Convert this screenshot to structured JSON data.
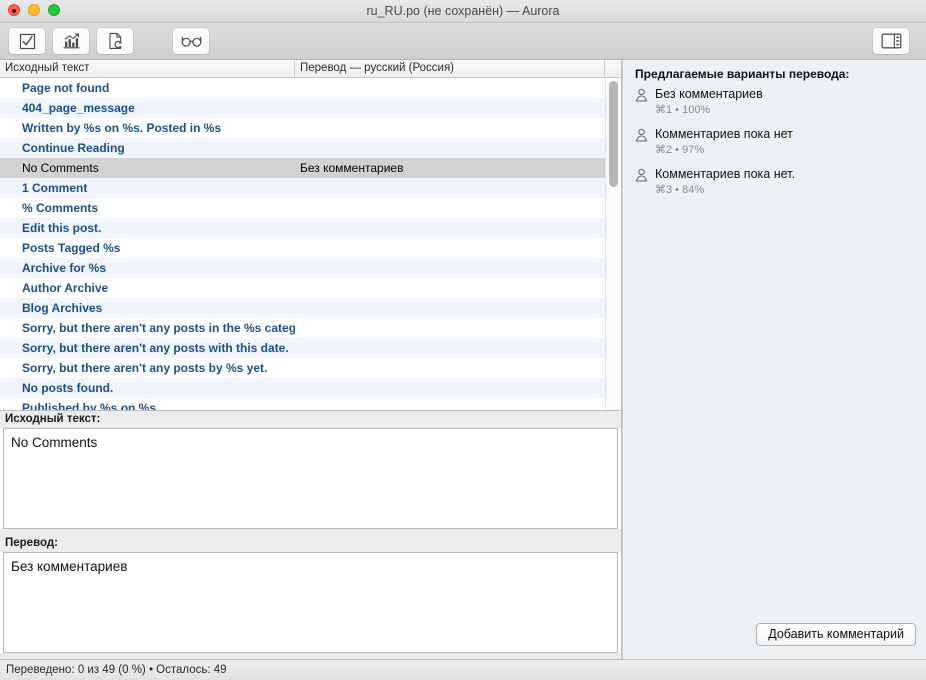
{
  "window": {
    "title": "ru_RU.po (не сохранён) — Aurora",
    "controls": {
      "close": "close",
      "minimize": "minimize",
      "maximize": "maximize"
    }
  },
  "toolbar": {
    "buttons": [
      {
        "name": "validate-button",
        "icon": "checkbox-check-icon",
        "label": "Проверить"
      },
      {
        "name": "statistics-button",
        "icon": "bar-chart-icon",
        "label": "Статистика"
      },
      {
        "name": "update-from-source-button",
        "icon": "document-refresh-icon",
        "label": "Обновить"
      },
      {
        "name": "proofread-button",
        "icon": "glasses-icon",
        "label": "Вычитка"
      }
    ],
    "sidebar_toggle": {
      "name": "sidebar-toggle-button",
      "icon": "sidebar-panel-icon",
      "label": "Боковая панель"
    }
  },
  "list": {
    "headers": {
      "source": "Исходный текст",
      "translation": "Перевод — русский (Россия)"
    },
    "rows": [
      {
        "source": "Page not found",
        "translation": "",
        "selected": false
      },
      {
        "source": "404_page_message",
        "translation": "",
        "selected": false
      },
      {
        "source": "Written by %s on %s. Posted in %s",
        "translation": "",
        "selected": false
      },
      {
        "source": "Continue Reading",
        "translation": "",
        "selected": false
      },
      {
        "source": "No Comments",
        "translation": "Без комментариев",
        "selected": true
      },
      {
        "source": "1 Comment",
        "translation": "",
        "selected": false
      },
      {
        "source": "% Comments",
        "translation": "",
        "selected": false
      },
      {
        "source": "Edit this post.",
        "translation": "",
        "selected": false
      },
      {
        "source": "Posts Tagged %s",
        "translation": "",
        "selected": false
      },
      {
        "source": "Archive for %s",
        "translation": "",
        "selected": false
      },
      {
        "source": "Author Archive",
        "translation": "",
        "selected": false
      },
      {
        "source": "Blog Archives",
        "translation": "",
        "selected": false
      },
      {
        "source": "Sorry, but there aren't any posts in the %s categ...",
        "translation": "",
        "selected": false
      },
      {
        "source": "Sorry, but there aren't any posts with this date.",
        "translation": "",
        "selected": false
      },
      {
        "source": "Sorry, but there aren't any posts by %s yet.",
        "translation": "",
        "selected": false
      },
      {
        "source": "No posts found.",
        "translation": "",
        "selected": false
      },
      {
        "source": "Published by %s on %s",
        "translation": "",
        "selected": false
      }
    ]
  },
  "editor": {
    "source_label": "Исходный текст:",
    "source_text": "No Comments",
    "translation_label": "Перевод:",
    "translation_text": "Без комментариев"
  },
  "suggestions": {
    "title": "Предлагаемые варианты перевода:",
    "items": [
      {
        "text": "Без комментариев",
        "shortcut": "⌘1",
        "score": "100%",
        "meta": "⌘1 • 100%"
      },
      {
        "text": "Комментариев пока нет",
        "shortcut": "⌘2",
        "score": "97%",
        "meta": "⌘2 • 97%"
      },
      {
        "text": "Комментариев пока нет.",
        "shortcut": "⌘3",
        "score": "84%",
        "meta": "⌘3 • 84%"
      }
    ],
    "add_comment_label": "Добавить комментарий"
  },
  "status": {
    "text": "Переведено: 0 из 49 (0 %)  •  Осталось: 49",
    "translated_count": 0,
    "total_count": 49,
    "percent": "0 %",
    "remaining": 49
  },
  "colors": {
    "row_text": "#1b4f8a",
    "row_alt_bg": "#f0f4fb",
    "row_selected_bg": "#d2d2d2",
    "right_panel_bg": "#edf1f4"
  }
}
